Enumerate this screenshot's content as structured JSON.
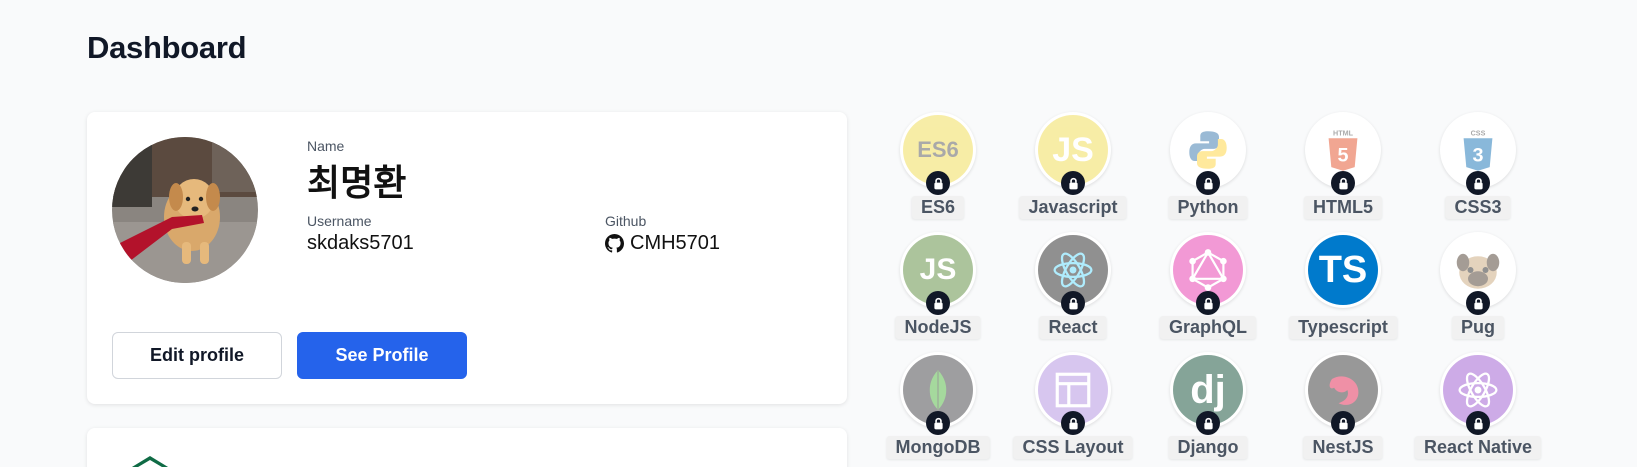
{
  "page": {
    "title": "Dashboard"
  },
  "profile": {
    "name_label": "Name",
    "name": "최명환",
    "username_label": "Username",
    "username": "skdaks5701",
    "github_label": "Github",
    "github": "CMH5701",
    "edit_button": "Edit profile",
    "see_button": "See Profile",
    "accent_color": "#2563eb"
  },
  "skills": [
    {
      "label": "ES6",
      "icon": "es6-icon",
      "locked": true,
      "text": "ES6"
    },
    {
      "label": "Javascript",
      "icon": "javascript-icon",
      "locked": true,
      "text": "JS"
    },
    {
      "label": "Python",
      "icon": "python-icon",
      "locked": true,
      "text": ""
    },
    {
      "label": "HTML5",
      "icon": "html5-icon",
      "locked": true,
      "text": "5"
    },
    {
      "label": "CSS3",
      "icon": "css3-icon",
      "locked": true,
      "text": "3"
    },
    {
      "label": "NodeJS",
      "icon": "nodejs-icon",
      "locked": true,
      "text": "JS"
    },
    {
      "label": "React",
      "icon": "react-icon",
      "locked": true,
      "text": ""
    },
    {
      "label": "GraphQL",
      "icon": "graphql-icon",
      "locked": true,
      "text": ""
    },
    {
      "label": "Typescript",
      "icon": "typescript-icon",
      "locked": false,
      "text": "TS"
    },
    {
      "label": "Pug",
      "icon": "pug-icon",
      "locked": true,
      "text": ""
    },
    {
      "label": "MongoDB",
      "icon": "mongodb-icon",
      "locked": true,
      "text": ""
    },
    {
      "label": "CSS Layout",
      "icon": "css-layout-icon",
      "locked": true,
      "text": ""
    },
    {
      "label": "Django",
      "icon": "django-icon",
      "locked": true,
      "text": "dj"
    },
    {
      "label": "NestJS",
      "icon": "nestjs-icon",
      "locked": true,
      "text": ""
    },
    {
      "label": "React Native",
      "icon": "react-native-icon",
      "locked": true,
      "text": ""
    }
  ]
}
